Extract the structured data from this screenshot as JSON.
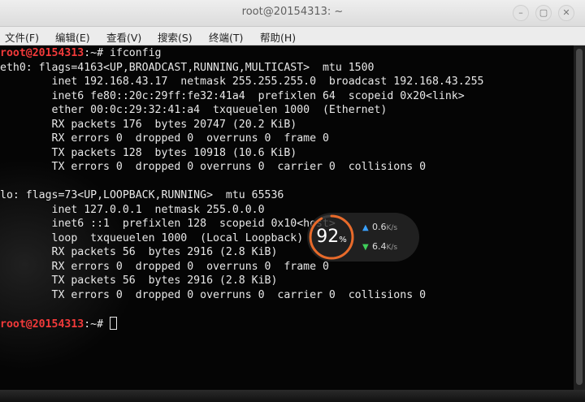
{
  "window": {
    "title": "root@20154313: ~",
    "controls": {
      "minimize": "–",
      "maximize": "▢",
      "close": "✕"
    }
  },
  "menu": {
    "items": [
      "文件(F)",
      "编辑(E)",
      "查看(V)",
      "搜索(S)",
      "终端(T)",
      "帮助(H)"
    ]
  },
  "terminal": {
    "prompt": "root@20154313",
    "prompt_suffix": ":~# ",
    "command": "ifconfig",
    "lines": [
      "eth0: flags=4163<UP,BROADCAST,RUNNING,MULTICAST>  mtu 1500",
      "        inet 192.168.43.17  netmask 255.255.255.0  broadcast 192.168.43.255",
      "        inet6 fe80::20c:29ff:fe32:41a4  prefixlen 64  scopeid 0x20<link>",
      "        ether 00:0c:29:32:41:a4  txqueuelen 1000  (Ethernet)",
      "        RX packets 176  bytes 20747 (20.2 KiB)",
      "        RX errors 0  dropped 0  overruns 0  frame 0",
      "        TX packets 128  bytes 10918 (10.6 KiB)",
      "        TX errors 0  dropped 0 overruns 0  carrier 0  collisions 0",
      "",
      "lo: flags=73<UP,LOOPBACK,RUNNING>  mtu 65536",
      "        inet 127.0.0.1  netmask 255.0.0.0",
      "        inet6 ::1  prefixlen 128  scopeid 0x10<host>",
      "        loop  txqueuelen 1000  (Local Loopback)",
      "        RX packets 56  bytes 2916 (2.8 KiB)",
      "        RX errors 0  dropped 0  overruns 0  frame 0",
      "        TX packets 56  bytes 2916 (2.8 KiB)",
      "        TX errors 0  dropped 0 overruns 0  carrier 0  collisions 0"
    ]
  },
  "net_widget": {
    "percent": "92",
    "percent_unit": "%",
    "percent_value": 0.92,
    "upload": "0.6",
    "upload_unit": "K/s",
    "download": "6.4",
    "download_unit": "K/s",
    "colors": {
      "ring": "#e86a2a",
      "up": "#3aa0ff",
      "down": "#3fcf5a"
    }
  }
}
